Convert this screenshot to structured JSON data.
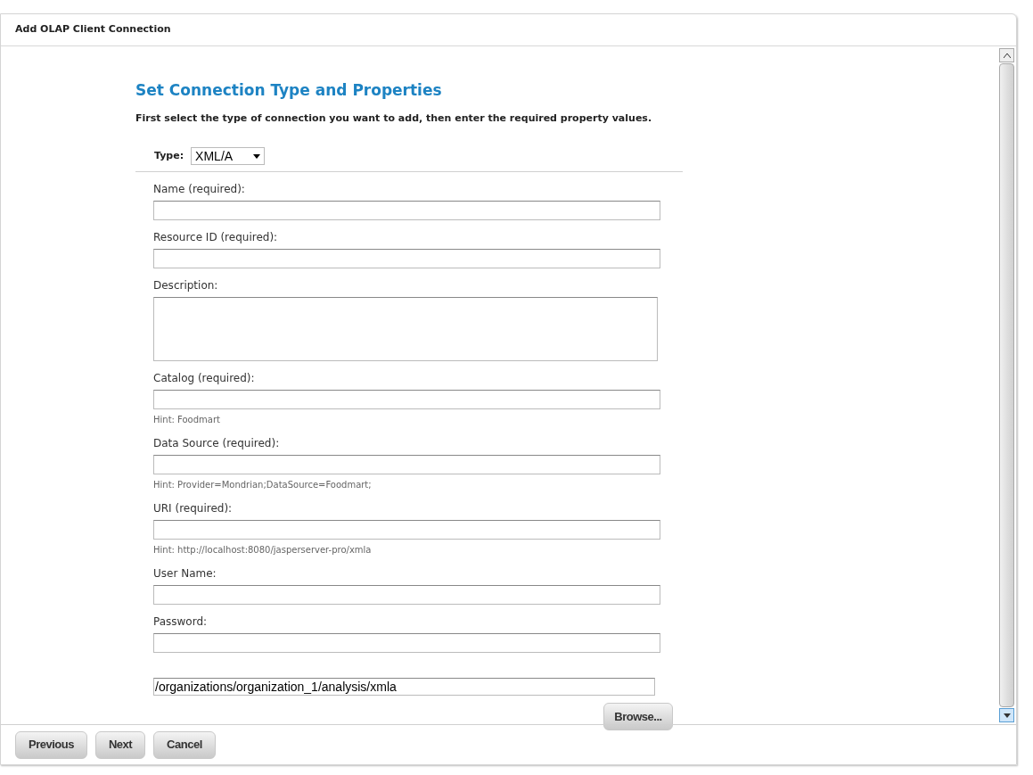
{
  "window": {
    "title": "Add OLAP Client Connection"
  },
  "heading": "Set Connection Type and Properties",
  "instructions": "First select the type of connection you want to add, then enter the required property values.",
  "type_select": {
    "label": "Type:",
    "value": "XML/A"
  },
  "fields": [
    {
      "kind": "text",
      "label": "Name (required):"
    },
    {
      "kind": "text",
      "label": "Resource ID (required):"
    },
    {
      "kind": "textarea",
      "label": "Description:"
    },
    {
      "kind": "text",
      "label": "Catalog (required):",
      "hint": "Hint: Foodmart"
    },
    {
      "kind": "text",
      "label": "Data Source (required):",
      "hint": "Hint: Provider=Mondrian;DataSource=Foodmart;"
    },
    {
      "kind": "text",
      "label": "URI (required):",
      "hint": "Hint: http://localhost:8080/jasperserver-pro/xmla"
    },
    {
      "kind": "text",
      "label": "User Name:"
    },
    {
      "kind": "text",
      "label": "Password:"
    }
  ],
  "path_field": {
    "value": "/organizations/organization_1/analysis/xmla"
  },
  "browse_button": "Browse...",
  "footer_buttons": [
    "Previous",
    "Next",
    "Cancel"
  ]
}
